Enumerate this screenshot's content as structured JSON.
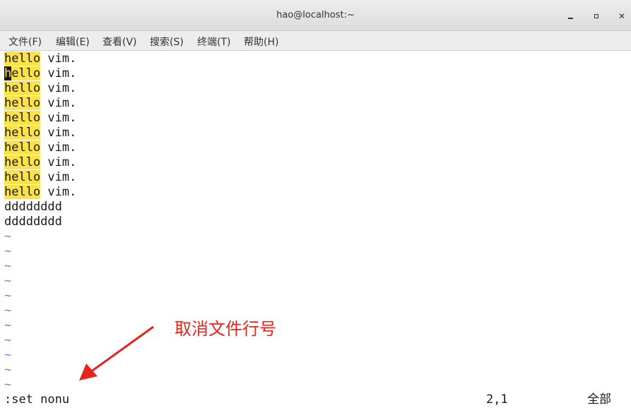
{
  "window": {
    "title": "hao@localhost:~"
  },
  "menu": [
    {
      "label": "文件(F)"
    },
    {
      "label": "编辑(E)"
    },
    {
      "label": "查看(V)"
    },
    {
      "label": "搜索(S)"
    },
    {
      "label": "终端(T)"
    },
    {
      "label": "帮助(H)"
    }
  ],
  "terminal": {
    "highlighted_word": "hello",
    "rest_of_line": " vim.",
    "cursor_char": "h",
    "cursor_rest": "ello",
    "plain_lines": [
      "dddddddd",
      "dddddddd"
    ],
    "tilde": "~",
    "command": ":set nonu",
    "cursor_pos": "2,1",
    "scope": "全部"
  },
  "annotation": {
    "text": "取消文件行号",
    "color": "#e8231b"
  },
  "colors": {
    "search_highlight": "#fce24a",
    "tilde": "#5c8fd6"
  }
}
